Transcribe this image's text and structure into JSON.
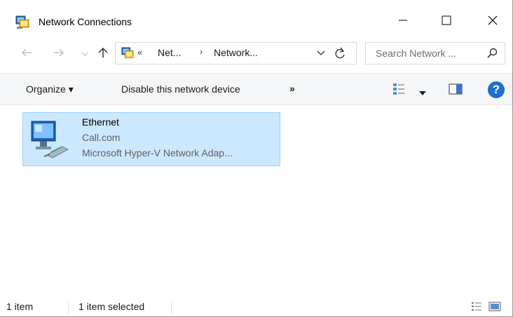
{
  "window": {
    "title": "Network Connections",
    "icon": "network-connections-icon",
    "controls": {
      "minimize": "minimize-icon",
      "maximize": "maximize-icon",
      "close": "close-icon"
    }
  },
  "nav": {
    "back": "back-arrow-icon",
    "forward": "forward-arrow-icon",
    "recent": "recent-locations-chevron-icon",
    "up": "up-arrow-icon",
    "address": {
      "overflow": "«",
      "crumbs": [
        "Net...",
        "Network..."
      ],
      "separator": "›"
    },
    "refresh": "refresh-icon",
    "search_placeholder": "Search Network ..."
  },
  "commands": {
    "organize": "Organize ▾",
    "disable": "Disable this network device",
    "more": "»"
  },
  "items": [
    {
      "name": "Ethernet",
      "network": "Call.com",
      "adapter": "Microsoft Hyper-V Network Adap...",
      "selected": true
    }
  ],
  "status": {
    "count": "1 item",
    "selected": "1 item selected"
  },
  "colors": {
    "selection_fill": "#cce8ff",
    "selection_border": "#99d1ff",
    "help_blue": "#1f6fd1"
  }
}
